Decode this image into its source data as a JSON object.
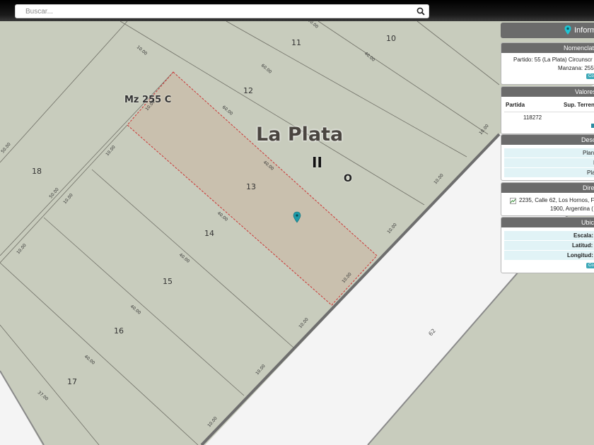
{
  "search": {
    "placeholder": "Buscar..."
  },
  "map": {
    "city_label": "La Plata",
    "roman_label": "II",
    "letter_label": "O",
    "manzana_label": "Mz 255 C",
    "street_label": "62",
    "parcels": [
      {
        "number": "10"
      },
      {
        "number": "11"
      },
      {
        "number": "12"
      },
      {
        "number": "13"
      },
      {
        "number": "14"
      },
      {
        "number": "15"
      },
      {
        "number": "16"
      },
      {
        "number": "17"
      },
      {
        "number": "18"
      }
    ],
    "dimensions": [
      "10.00",
      "10.00",
      "40.00",
      "60.00",
      "10.00",
      "60.00",
      "40.00",
      "10.00",
      "10.00",
      "10.00",
      "10.00",
      "50.00",
      "10.00",
      "50.00",
      "10.00",
      "10.00",
      "40.00",
      "40.00",
      "10.00",
      "10.00",
      "40.00",
      "10.00",
      "40.00",
      "37.00",
      "10.00",
      "10.00"
    ],
    "colors": {
      "ground": "#c8ccbd",
      "road": "#f4f4f4",
      "selected_fill": "#c9c0ae",
      "selected_outline": "#cc3333",
      "curb": "#6e6e6e",
      "marker": "#1d9aa8"
    }
  },
  "sidebar": {
    "info_button": "Inform",
    "nomenclatura": {
      "title": "Nomenclatu",
      "line1": "Partido: 55 (La Plata) Circunscr",
      "line2": "Manzana: 255",
      "button": "Co"
    },
    "valores": {
      "title": "Valores",
      "col1": "Partida",
      "col2": "Sup. Terren",
      "partida": "118272"
    },
    "descargas": {
      "title": "Desc",
      "rows": [
        "Plano",
        "D",
        "Pla"
      ]
    },
    "direccion": {
      "title": "Direc",
      "line1": "2235, Calle 62, Los Hornos, F",
      "line2": "1900, Argentina ("
    },
    "ubicacion": {
      "title": "Ubica",
      "escala": "Escala:",
      "latitud": "Latitud:",
      "longitud": "Longitud:",
      "button": "Co"
    }
  }
}
